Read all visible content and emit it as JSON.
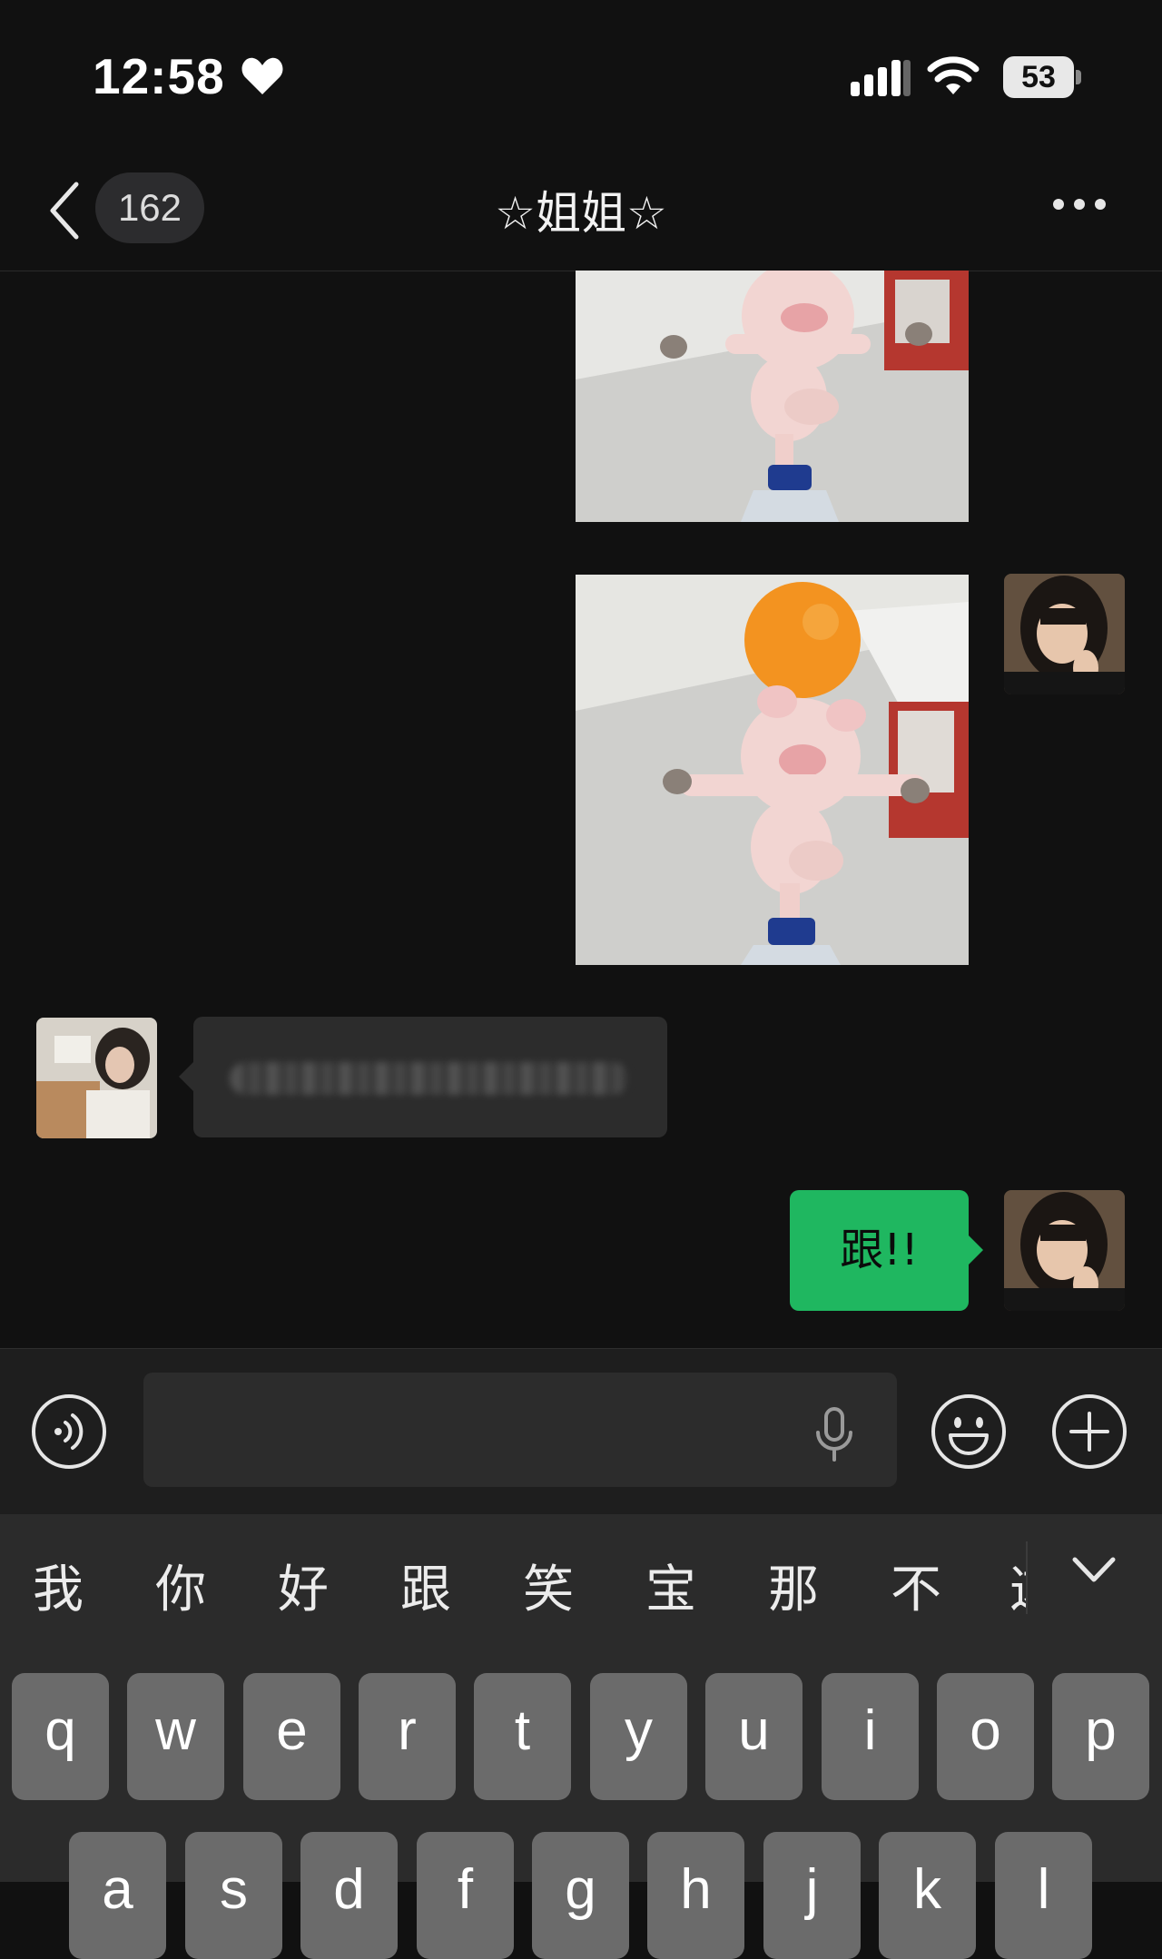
{
  "status_bar": {
    "time": "12:58",
    "battery_level": "53",
    "icons": [
      "heart-icon",
      "signal-icon",
      "wifi-icon",
      "battery-icon"
    ]
  },
  "header": {
    "unread_count": "162",
    "title": "☆姐姐☆"
  },
  "messages": [
    {
      "type": "image",
      "sender": "self",
      "content": "pig-balancing-on-bottle"
    },
    {
      "type": "image",
      "sender": "self",
      "content": "pig-with-orange-on-head"
    },
    {
      "type": "text",
      "sender": "friend",
      "text": "",
      "blurred": true
    },
    {
      "type": "text",
      "sender": "self",
      "text": "跟!!"
    }
  ],
  "input_bar": {
    "value": "",
    "placeholder": ""
  },
  "keyboard": {
    "candidates": [
      "我",
      "你",
      "好",
      "跟",
      "笑",
      "宝",
      "那",
      "不",
      "这"
    ],
    "row1": [
      "q",
      "w",
      "e",
      "r",
      "t",
      "y",
      "u",
      "i",
      "o",
      "p"
    ],
    "row2": [
      "a",
      "s",
      "d",
      "f",
      "g",
      "h",
      "j",
      "k",
      "l"
    ]
  },
  "colors": {
    "background": "#111111",
    "self_bubble": "#1fb760",
    "friend_bubble": "#2c2c2c",
    "key": "#6b6b6b"
  }
}
